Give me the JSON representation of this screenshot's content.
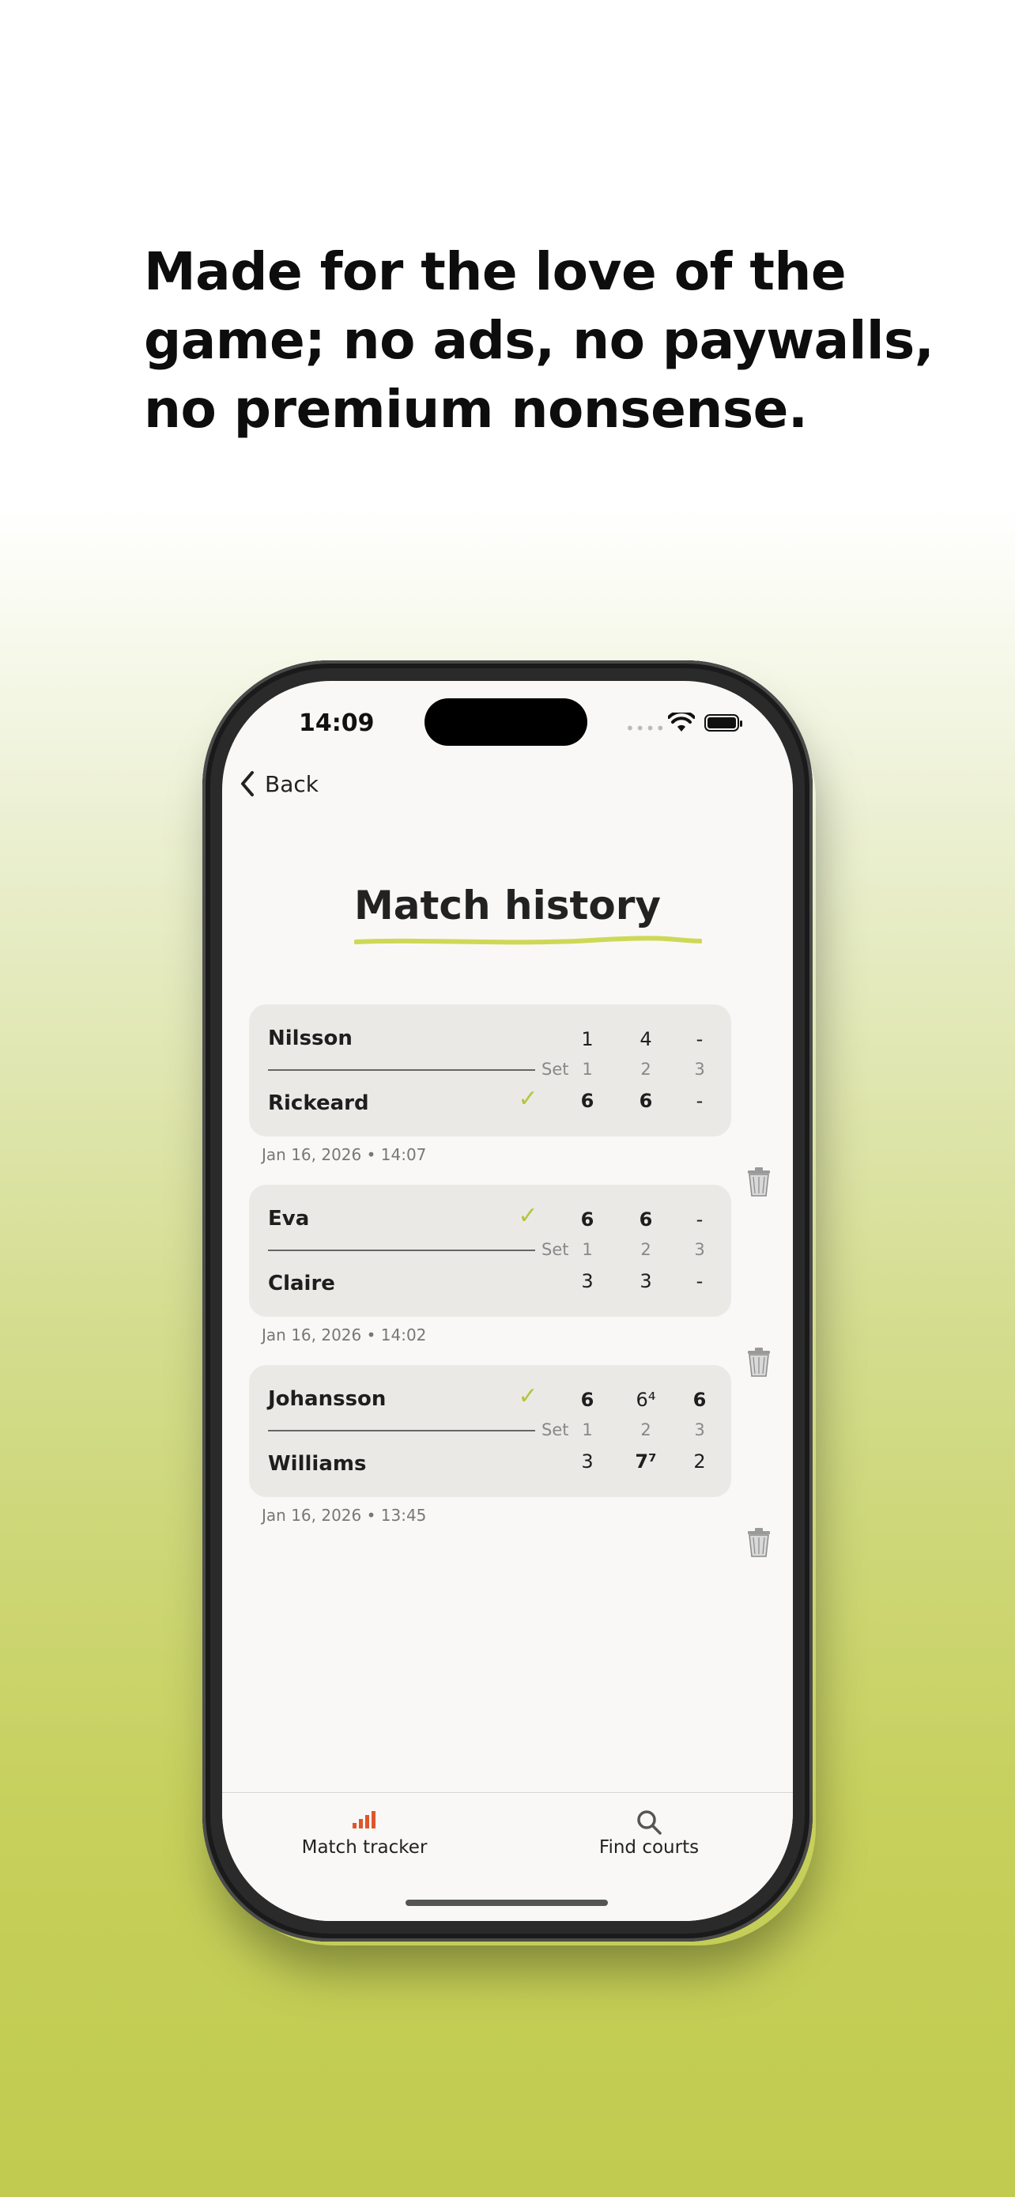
{
  "headline": {
    "line1": "Made for the love of the",
    "line2": "game; no ads, no paywalls,",
    "line3": "no premium nonsense."
  },
  "status_bar": {
    "time": "14:09"
  },
  "nav": {
    "back_label": "Back"
  },
  "page": {
    "title": "Match history"
  },
  "set_label": "Set",
  "set_numbers": [
    "1",
    "2",
    "3"
  ],
  "matches": [
    {
      "player1": "Nilsson",
      "player2": "Rickeard",
      "winner": "player2",
      "scores_top": [
        "1",
        "4",
        "-"
      ],
      "scores_bottom": [
        "6",
        "6",
        "-"
      ],
      "date": "Jan 16, 2026 • 14:07"
    },
    {
      "player1": "Eva",
      "player2": "Claire",
      "winner": "player1",
      "scores_top": [
        "6",
        "6",
        "-"
      ],
      "scores_bottom": [
        "3",
        "3",
        "-"
      ],
      "date": "Jan 16, 2026 • 14:02"
    },
    {
      "player1": "Johansson",
      "player2": "Williams",
      "winner": "player1",
      "scores_top": [
        "6",
        "6⁴",
        "6"
      ],
      "scores_bottom": [
        "3",
        "7⁷",
        "2"
      ],
      "date": "Jan 16, 2026 • 13:45"
    }
  ],
  "tabs": [
    {
      "label": "Match tracker",
      "icon": "bar-chart-icon"
    },
    {
      "label": "Find courts",
      "icon": "search-icon"
    }
  ],
  "colors": {
    "accent_green": "#b4c63d",
    "tab_icon_orange": "#e0562a",
    "background_green": "#c0cb4f"
  }
}
